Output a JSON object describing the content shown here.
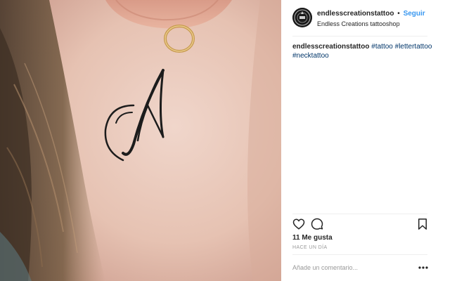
{
  "post": {
    "image_alt_icon": "tattoo-photo"
  },
  "header": {
    "username": "endlesscreationstattoo",
    "separator": "•",
    "follow_label": "Seguir",
    "location": "Endless Creations tattooshop"
  },
  "caption": {
    "username": "endlesscreationstattoo",
    "hashtags": [
      "#tattoo",
      "#lettertattoo",
      "#necktattoo"
    ]
  },
  "actions": {
    "like_icon": "heart-icon",
    "comment_icon": "comment-icon",
    "save_icon": "bookmark-icon"
  },
  "likes": "11 Me gusta",
  "timestamp": "HACE UN DÍA",
  "comment_box": {
    "placeholder": "Añade un comentario...",
    "more_icon": "more-options-icon"
  },
  "colors": {
    "follow": "#3897f0",
    "hashtag": "#003569",
    "muted": "#999999",
    "divider": "#efefef"
  }
}
